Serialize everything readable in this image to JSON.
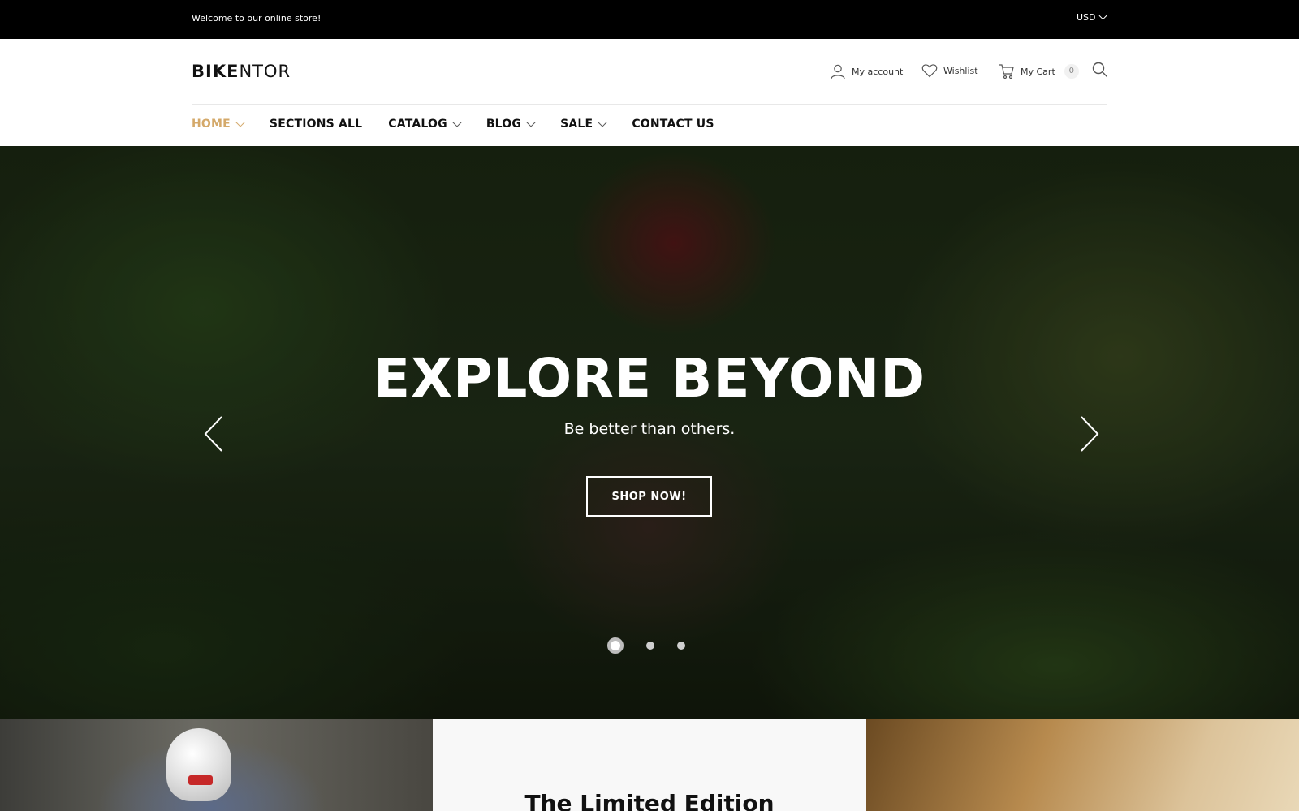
{
  "topbar": {
    "welcome": "Welcome to our online store!",
    "currency": "USD"
  },
  "header": {
    "logo_bold": "BIKE",
    "logo_light": "NTOR",
    "account_label": "My account",
    "wishlist_label": "Wishlist",
    "cart_label": "My Cart",
    "cart_count": "0"
  },
  "nav": {
    "items": [
      {
        "label": "HOME",
        "has_dropdown": true,
        "active": true
      },
      {
        "label": "SECTIONS ALL",
        "has_dropdown": false
      },
      {
        "label": "CATALOG",
        "has_dropdown": true
      },
      {
        "label": "BLOG",
        "has_dropdown": true
      },
      {
        "label": "SALE",
        "has_dropdown": true
      },
      {
        "label": "CONTACT US",
        "has_dropdown": false
      }
    ]
  },
  "hero": {
    "title": "EXPLORE BEYOND",
    "subtitle": "Be better than others.",
    "cta": "SHOP NOW!",
    "active_slide": 1,
    "slide_count": 3
  },
  "promo": {
    "title": "The Limited Edition"
  },
  "colors": {
    "accent": "#d4a96a",
    "topbar_bg": "#000000"
  }
}
